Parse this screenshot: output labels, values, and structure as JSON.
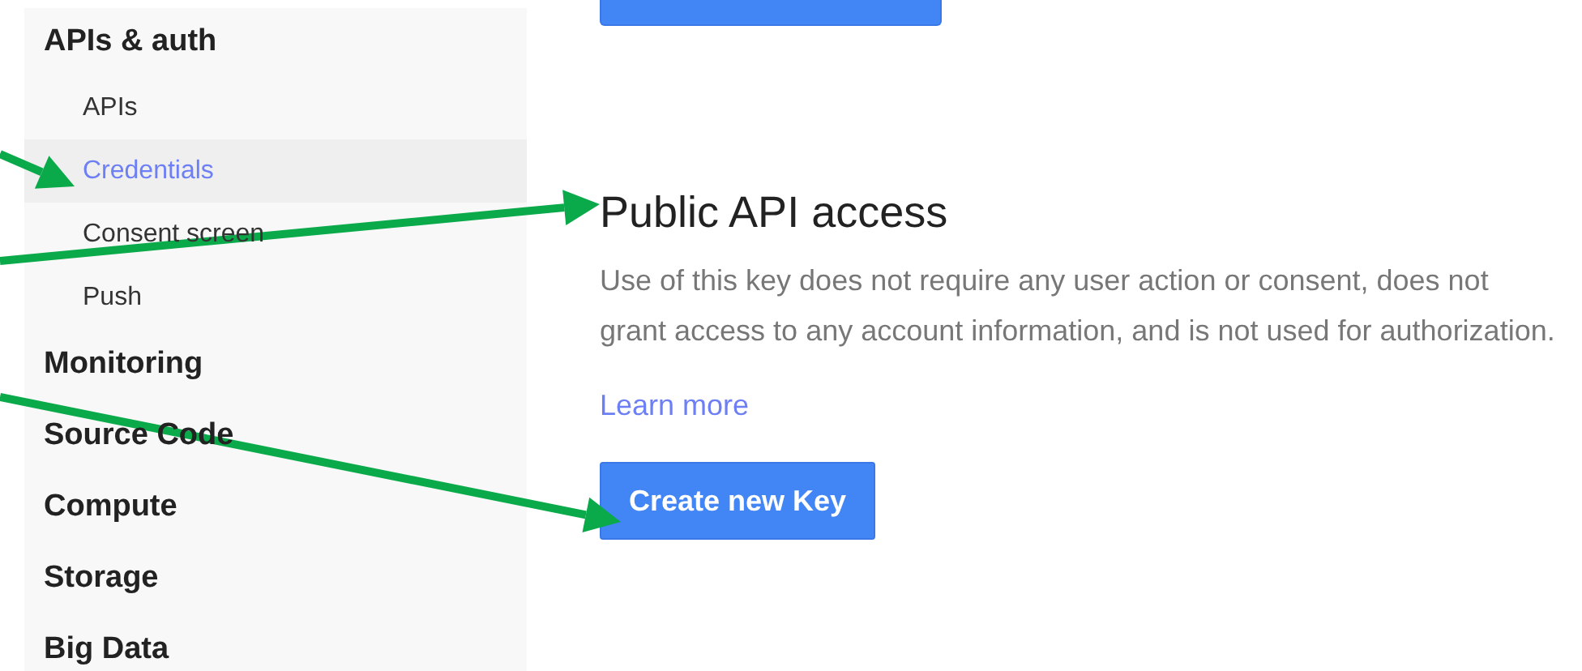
{
  "sidebar": {
    "sections": [
      {
        "label": "APIs & auth",
        "children": [
          {
            "label": "APIs",
            "selected": false
          },
          {
            "label": "Credentials",
            "selected": true
          },
          {
            "label": "Consent screen",
            "selected": false
          },
          {
            "label": "Push",
            "selected": false
          }
        ]
      },
      {
        "label": "Monitoring"
      },
      {
        "label": "Source Code"
      },
      {
        "label": "Compute"
      },
      {
        "label": "Storage"
      },
      {
        "label": "Big Data"
      }
    ]
  },
  "main": {
    "heading": "Public API access",
    "description": "Use of this key does not require any user action or consent, does not grant access to any account information, and is not used for authorization.",
    "link": "Learn more",
    "button": "Create new Key"
  }
}
